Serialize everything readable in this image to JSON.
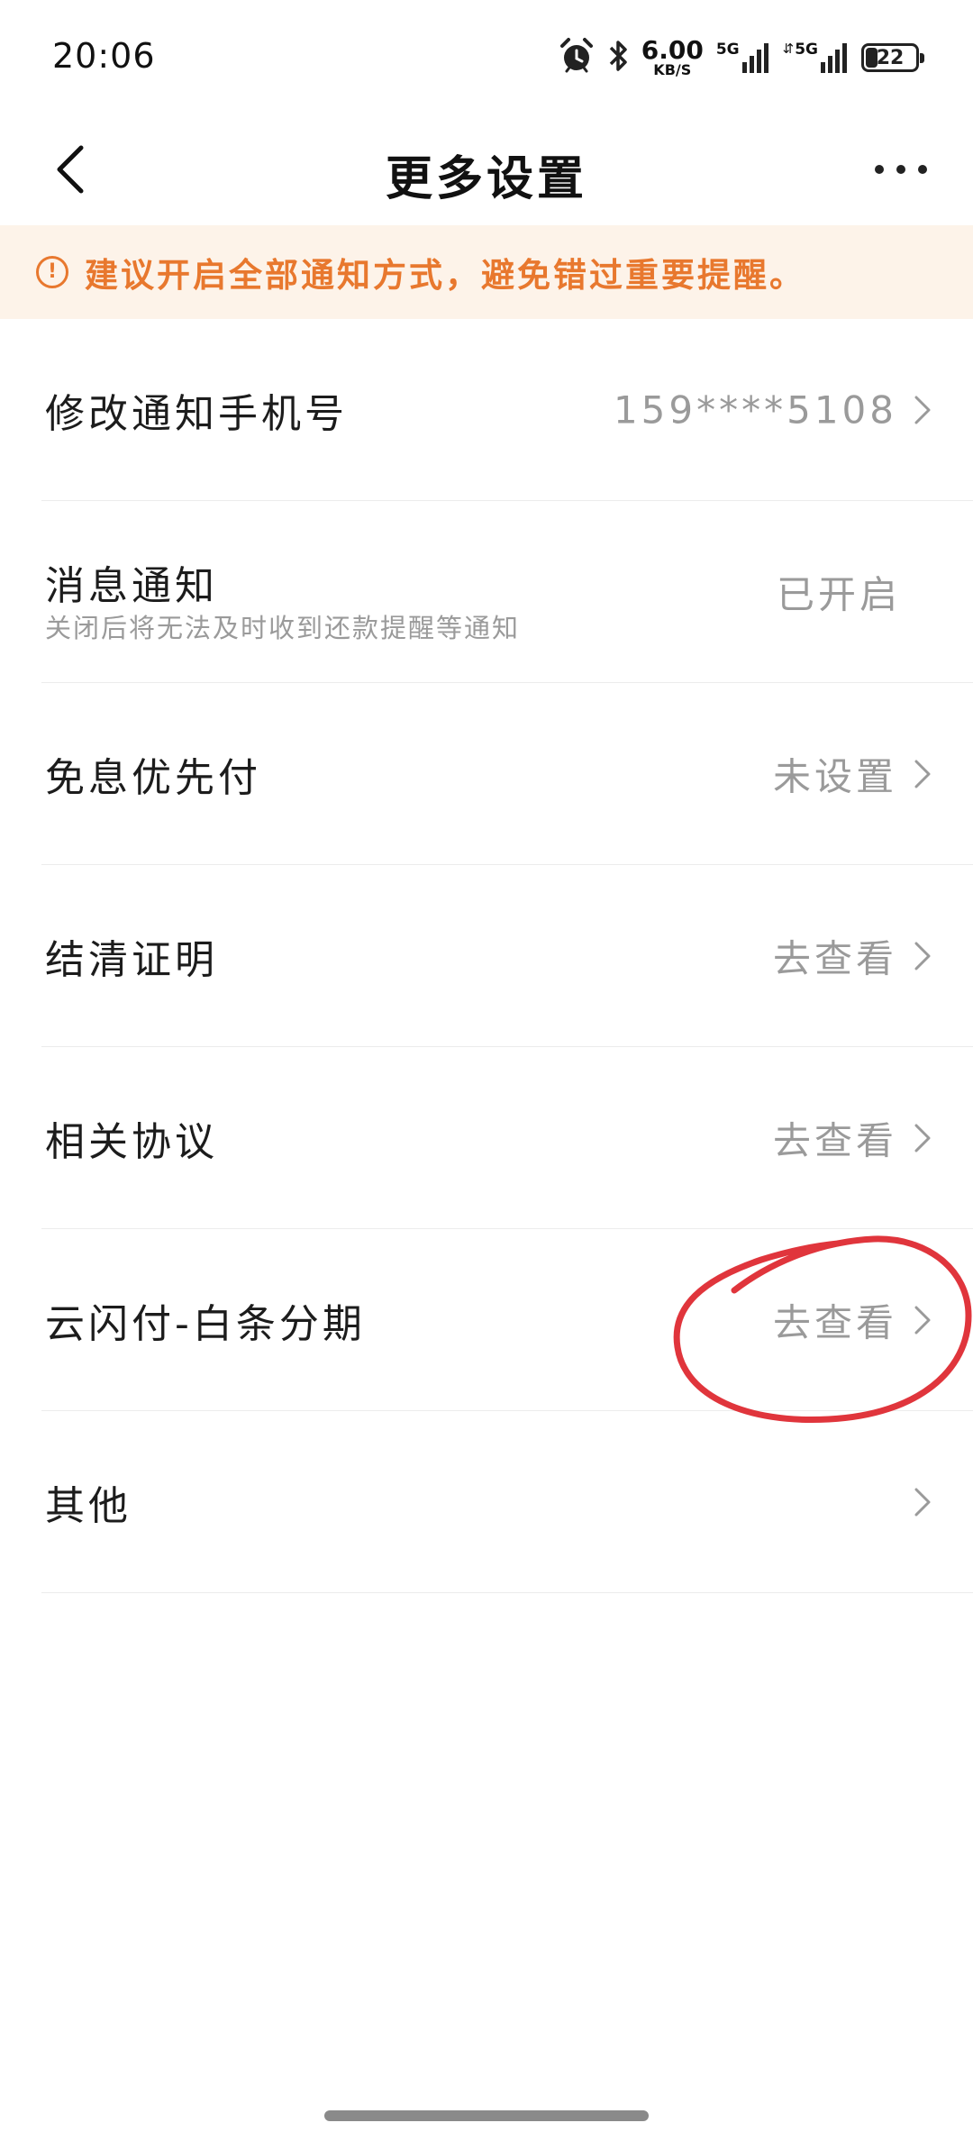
{
  "status_bar": {
    "time": "20:06",
    "net_speed_value": "6.00",
    "net_speed_unit": "KB/S",
    "signal_1_label": "5G",
    "signal_2_label": "5G",
    "battery_level": "22",
    "icons": [
      "alarm-icon",
      "bluetooth-icon",
      "signal-5g-icon",
      "signal-5g-icon",
      "battery-icon"
    ]
  },
  "nav": {
    "title": "更多设置",
    "back_icon": "chevron-left-icon",
    "more_icon": "more-horizontal-icon"
  },
  "notice": {
    "icon": "warning-circle-icon",
    "text": "建议开启全部通知方式，避免错过重要提醒。",
    "color": "#e8782e",
    "background": "#fdf3e9"
  },
  "settings": [
    {
      "label": "修改通知手机号",
      "value": "159****5108",
      "chevron": true
    },
    {
      "label": "消息通知",
      "subtitle": "关闭后将无法及时收到还款提醒等通知",
      "value": "已开启",
      "chevron": false
    },
    {
      "label": "免息优先付",
      "value": "未设置",
      "chevron": true
    },
    {
      "label": "结清证明",
      "value": "去查看",
      "chevron": true
    },
    {
      "label": "相关协议",
      "value": "去查看",
      "chevron": true
    },
    {
      "label": "云闪付-白条分期",
      "value": "去查看",
      "chevron": true
    },
    {
      "label": "其他",
      "value": "",
      "chevron": true
    }
  ],
  "colors": {
    "annotation": "#e0353c",
    "secondary_text": "#9a9a9a"
  }
}
